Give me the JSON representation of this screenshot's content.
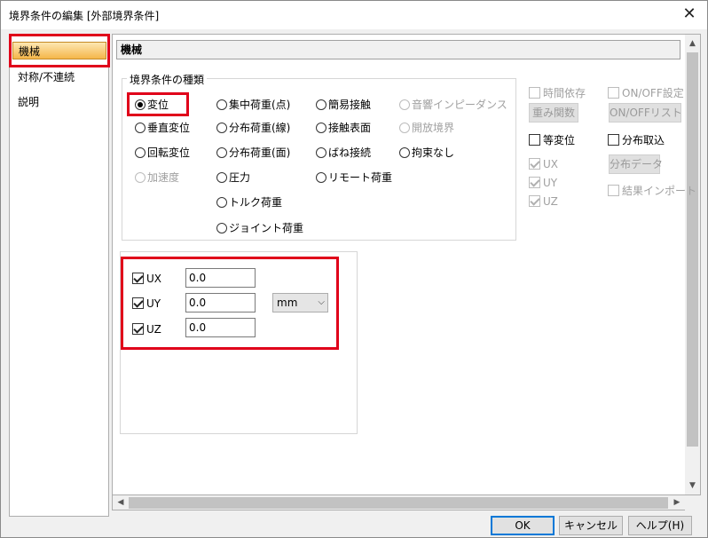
{
  "window": {
    "title": "境界条件の編集 [外部境界条件]",
    "close_glyph": "✕"
  },
  "nav": {
    "items": [
      "機械",
      "対称/不連続",
      "説明"
    ],
    "selected": 0
  },
  "panel": {
    "header": "機械"
  },
  "boundary_types": {
    "group_title": "境界条件の種類",
    "selected": "変位",
    "options": {
      "displacement": "変位",
      "vertical_displacement": "垂直変位",
      "rotational_displacement": "回転変位",
      "acceleration": "加速度",
      "concentrated_load": "集中荷重(点)",
      "distributed_load_line": "分布荷重(線)",
      "distributed_load_surface": "分布荷重(面)",
      "pressure": "圧力",
      "torque_load": "トルク荷重",
      "joint_load": "ジョイント荷重",
      "simple_contact": "簡易接触",
      "contact_surface": "接触表面",
      "spring_contact": "ばね接続",
      "remote_load": "リモート荷重",
      "acoustic_impedance": "音響インピーダンス",
      "open_boundary": "開放境界",
      "unconstrained": "拘束なし"
    }
  },
  "side_options": {
    "time_dependent": "時間依存",
    "weight_function_button": "重み関数",
    "onoff_setting": "ON/OFF設定",
    "onoff_list_button": "ON/OFFリスト",
    "equal_displacement": "等変位",
    "distribution_import": "分布取込",
    "distribution_data_button": "分布データ",
    "result_import": "結果インポート",
    "axes": [
      "UX",
      "UY",
      "UZ"
    ]
  },
  "values": {
    "ux": {
      "label": "UX",
      "checked": true,
      "value": "0.0"
    },
    "uy": {
      "label": "UY",
      "checked": true,
      "value": "0.0"
    },
    "uz": {
      "label": "UZ",
      "checked": true,
      "value": "0.0"
    },
    "unit": "mm"
  },
  "buttons": {
    "ok": "OK",
    "cancel": "キャンセル",
    "help": "ヘルプ(H)"
  },
  "colors": {
    "highlight_red": "#e0001a",
    "selected_nav": "#f5b64a",
    "default_button_border": "#0078d7"
  }
}
